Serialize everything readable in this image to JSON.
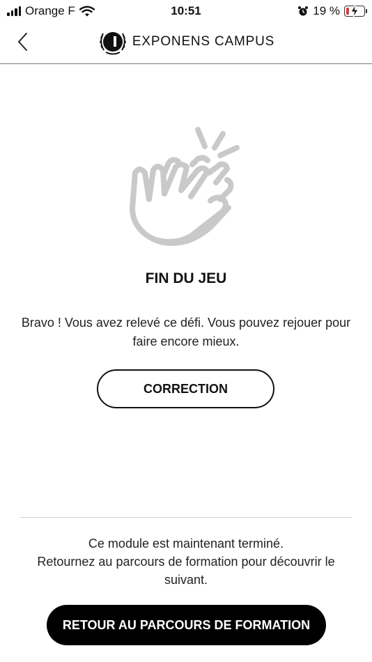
{
  "status_bar": {
    "carrier": "Orange F",
    "time": "10:51",
    "battery_percent": "19 %",
    "battery_level": 0.19,
    "signal_bars": 4,
    "icons": [
      "signal-icon",
      "wifi-icon",
      "alarm-icon",
      "battery-charging-icon"
    ]
  },
  "header": {
    "brand": "EXPONENS CAMPUS",
    "back_icon": "chevron-left-icon",
    "logo_icon": "laurel-logo-icon"
  },
  "content": {
    "illustration_icon": "clapping-hands-icon",
    "title": "FIN DU JEU",
    "message": "Bravo ! Vous avez relevé ce défi. Vous pouvez rejouer pour faire encore mieux.",
    "correction_button": "CORRECTION"
  },
  "footer": {
    "completion_line1": "Ce module est maintenant terminé.",
    "completion_line2": "Retournez au parcours de formation pour découvrir le suivant.",
    "return_button": "RETOUR AU PARCOURS DE FORMATION"
  },
  "colors": {
    "text": "#111111",
    "illustration": "#c9c9c9",
    "battery_low": "#e53935",
    "button_dark": "#000000"
  }
}
